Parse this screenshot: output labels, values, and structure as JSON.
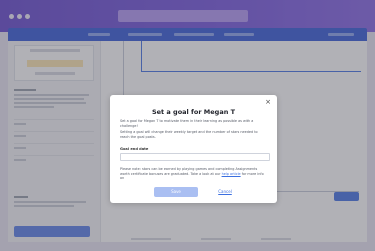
{
  "modal": {
    "title": "Set a goal for Megan T",
    "p1": "Set a goal for Megan T to motivate them in their learning as possible as with a challenge!",
    "p2": "Setting a goal will change their weekly target and the number of stars needed to reach the goal posts.",
    "field_label": "Goal end date",
    "field_value": "",
    "help_prefix": "Please note: stars can be earned by playing games and completing Assignments worth certificate bonuses are graduated. Take a look at our",
    "help_link": "help article",
    "help_suffix": "for more info on",
    "save_label": "Save",
    "cancel_label": "Cancel",
    "close_glyph": "×"
  }
}
